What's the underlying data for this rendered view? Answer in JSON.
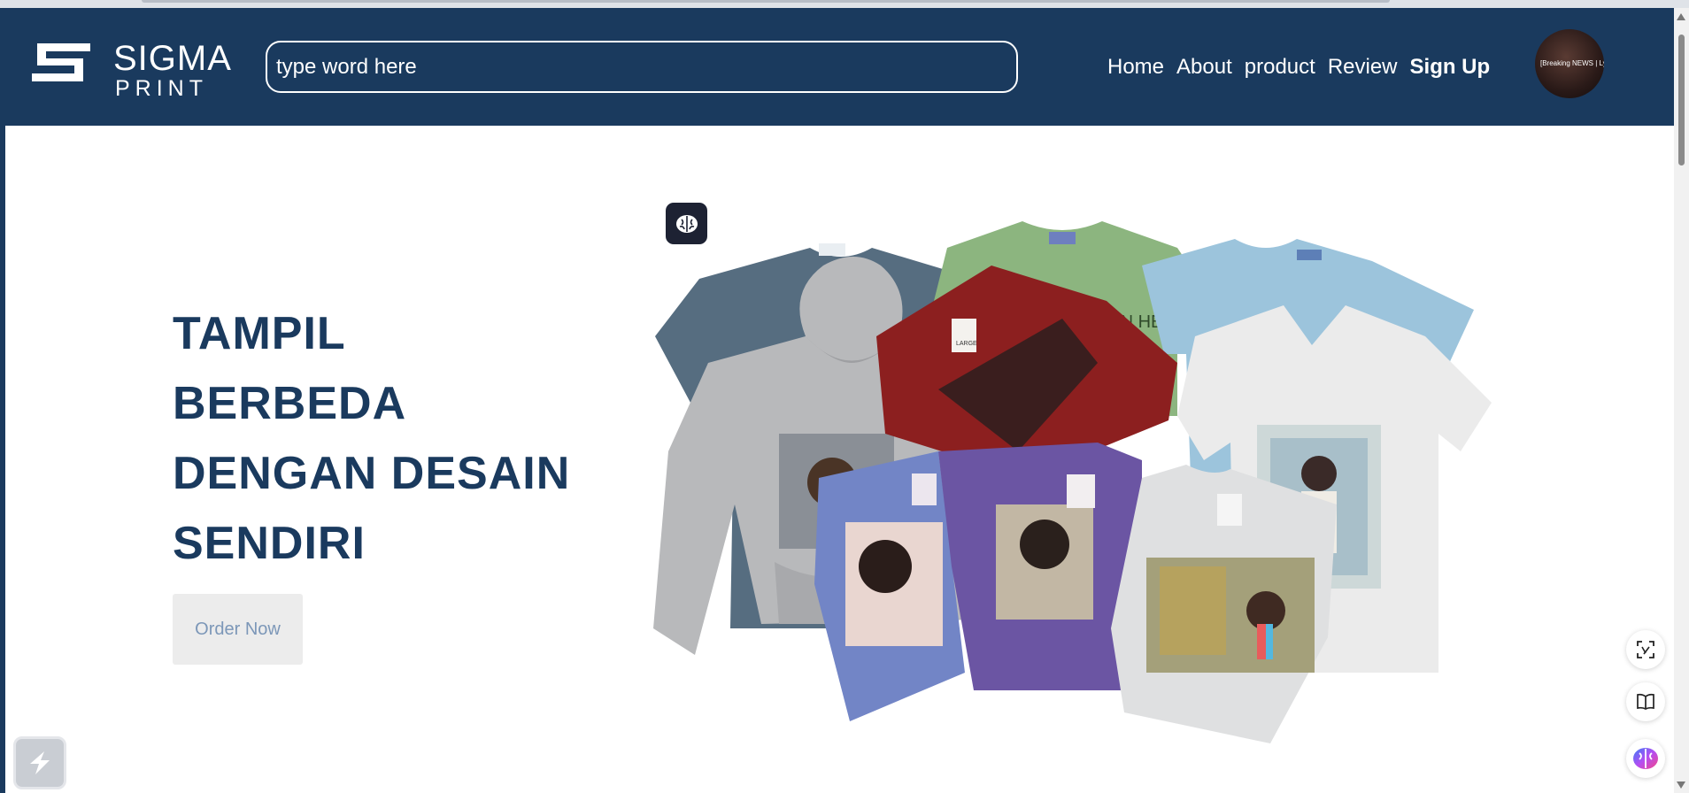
{
  "header": {
    "logo": {
      "line1": "SIGMA",
      "line2": "PRINT"
    },
    "search": {
      "placeholder": "type word here"
    },
    "nav": [
      {
        "label": "Home"
      },
      {
        "label": "About"
      },
      {
        "label": "product"
      },
      {
        "label": "Review"
      },
      {
        "label": "Sign Up"
      }
    ],
    "avatar_text": "[Breaking NEWS | Lyrics]"
  },
  "hero": {
    "headline_lines": [
      "TAMPIL",
      "BERBEDA",
      "DENGAN DESAIN",
      "SENDIRI"
    ],
    "cta_label": "Order Now",
    "green_shirt_print": "YOUR DESIGN HE",
    "tag_text": "LARGE"
  },
  "icons": {
    "brain_badge": "brain-icon",
    "side_tools": [
      "scan-translate-icon",
      "book-icon",
      "ai-brain-icon"
    ],
    "bottom_widget": "bolt-logo-icon"
  },
  "colors": {
    "brand_navy": "#1a3a5e",
    "cta_bg": "#ececec",
    "cta_text": "#7c97b8",
    "page_bg": "#ffffff"
  }
}
